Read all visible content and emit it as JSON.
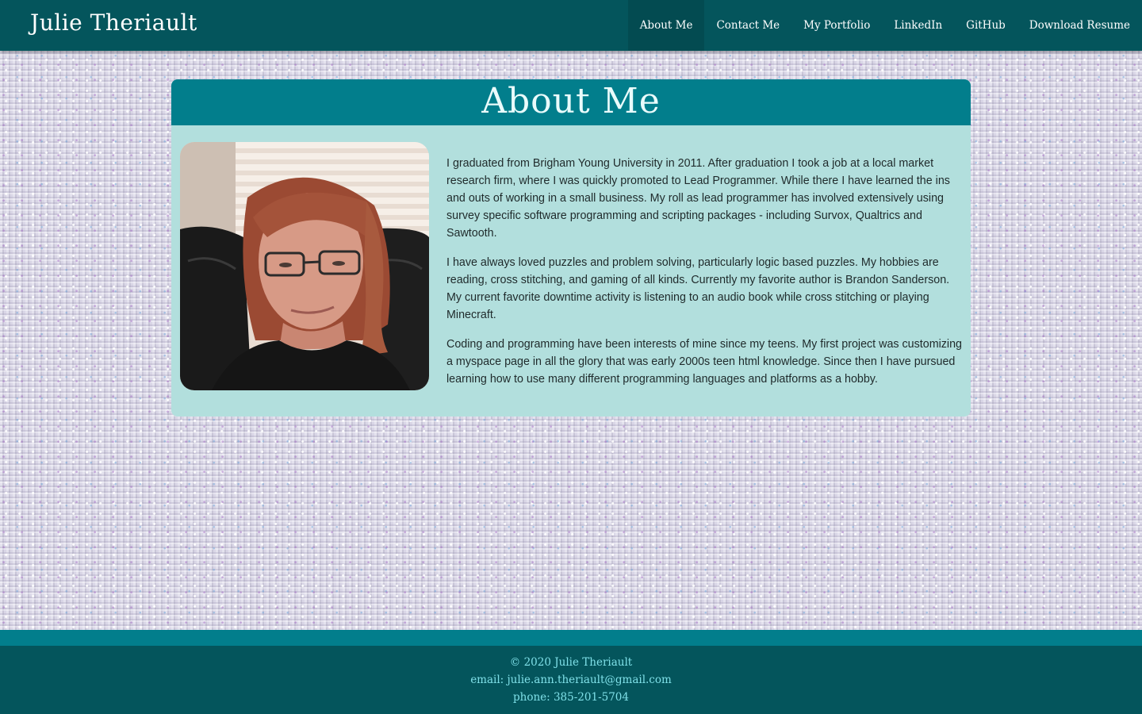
{
  "header": {
    "brand": "Julie Theriault",
    "nav": [
      {
        "label": "About Me",
        "active": true
      },
      {
        "label": "Contact Me",
        "active": false
      },
      {
        "label": "My Portfolio",
        "active": false
      },
      {
        "label": "LinkedIn",
        "active": false
      },
      {
        "label": "GitHub",
        "active": false
      },
      {
        "label": "Download Resume",
        "active": false
      }
    ]
  },
  "about": {
    "title": "About Me",
    "paragraphs": [
      "I graduated from Brigham Young University in 2011. After graduation I took a job at a local market research firm, where I was quickly promoted to Lead Programmer. While there I have learned the ins and outs of working in a small business. My roll as lead programmer has involved extensively using survey specific software programming and scripting packages - including Survox, Qualtrics and Sawtooth.",
      "I have always loved puzzles and problem solving, particularly logic based puzzles. My hobbies are reading, cross stitching, and gaming of all kinds. Currently my favorite author is Brandon Sanderson. My current favorite downtime activity is listening to an audio book while cross stitching or playing Minecraft.",
      "Coding and programming have been interests of mine since my teens. My first project was customizing a myspace page in all the glory that was early 2000s teen html knowledge. Since then I have pursued learning how to use many different programming languages and platforms as a hobby."
    ]
  },
  "footer": {
    "copyright": "© 2020 Julie Theriault",
    "email": "email: julie.ann.theriault@gmail.com",
    "phone": "phone: 385-201-5704"
  },
  "colors": {
    "navbar": "#04555c",
    "accent": "#027e8c",
    "card": "#b2dfdd",
    "footer_text": "#7fe0e8"
  }
}
